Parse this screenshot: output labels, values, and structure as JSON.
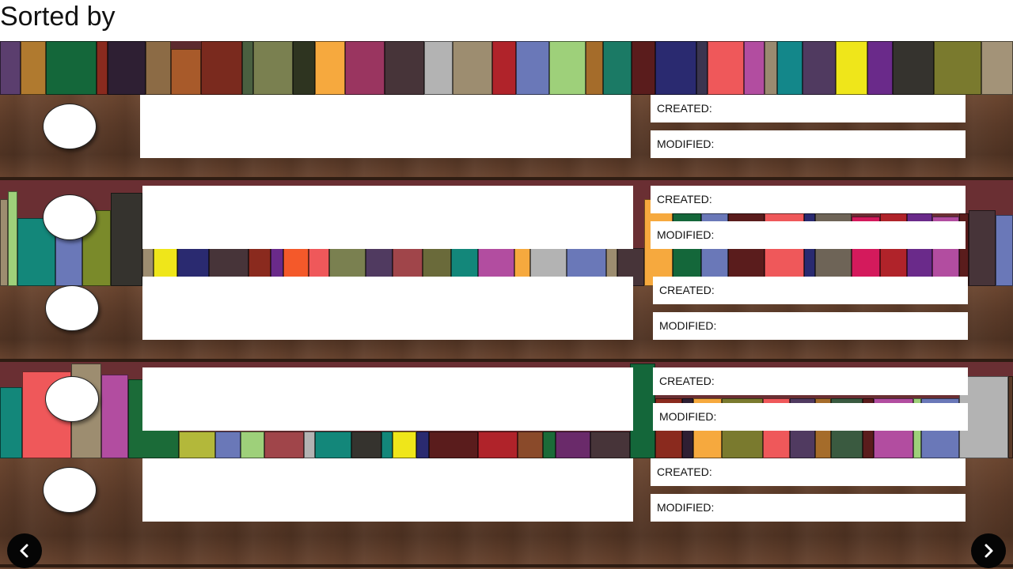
{
  "header": {
    "title": "Sorted by"
  },
  "entries": [
    {
      "created_label": "CREATED:",
      "modified_label": "MODIFIED:"
    },
    {
      "created_label": "CREATED:",
      "modified_label": "MODIFIED:"
    },
    {
      "created_label": "CREATED:",
      "modified_label": "MODIFIED:"
    },
    {
      "created_label": "CREATED:",
      "modified_label": "MODIFIED:"
    },
    {
      "created_label": "CREATED:",
      "modified_label": "MODIFIED:"
    }
  ],
  "navigation": {
    "prev_icon": "chevron-left-icon",
    "next_icon": "chevron-right-icon"
  },
  "colors": {
    "wood": "#5a3a28",
    "nav_button": "#050505",
    "panel": "#ffffff"
  }
}
